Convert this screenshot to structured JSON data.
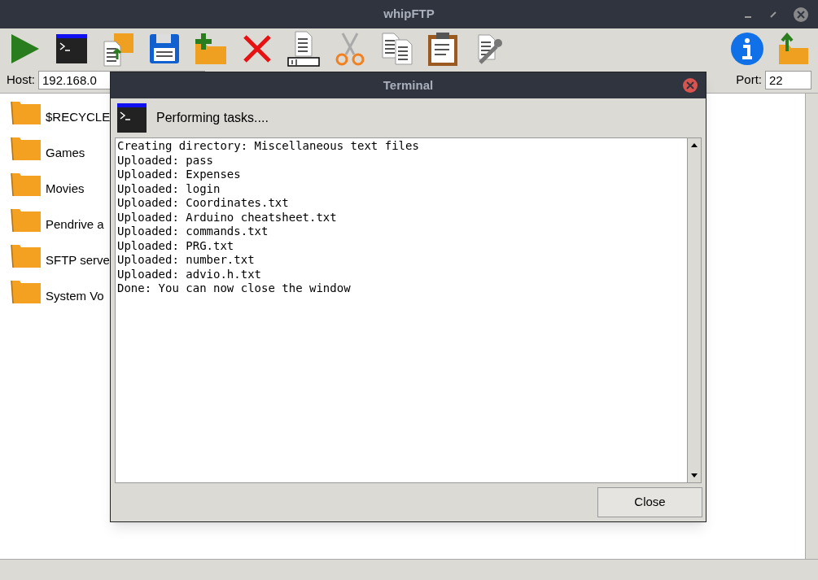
{
  "window": {
    "title": "whipFTP"
  },
  "connection": {
    "host_label": "Host:",
    "host_value": "192.168.0",
    "port_label": "Port:",
    "port_value": "22"
  },
  "files": [
    {
      "name": "$RECYCLE"
    },
    {
      "name": "Games"
    },
    {
      "name": "Movies"
    },
    {
      "name": "Pendrive a"
    },
    {
      "name": "SFTP serve"
    },
    {
      "name": "System Vo"
    }
  ],
  "dialog": {
    "title": "Terminal",
    "status": "Performing tasks....",
    "log": [
      "Creating directory: Miscellaneous text files",
      "Uploaded: pass",
      "Uploaded: Expenses",
      "Uploaded: login",
      "Uploaded: Coordinates.txt",
      "Uploaded: Arduino cheatsheet.txt",
      "Uploaded: commands.txt",
      "Uploaded: PRG.txt",
      "Uploaded: number.txt",
      "Uploaded: advio.h.txt",
      "Done: You can now close the window"
    ],
    "close_button": "Close"
  }
}
